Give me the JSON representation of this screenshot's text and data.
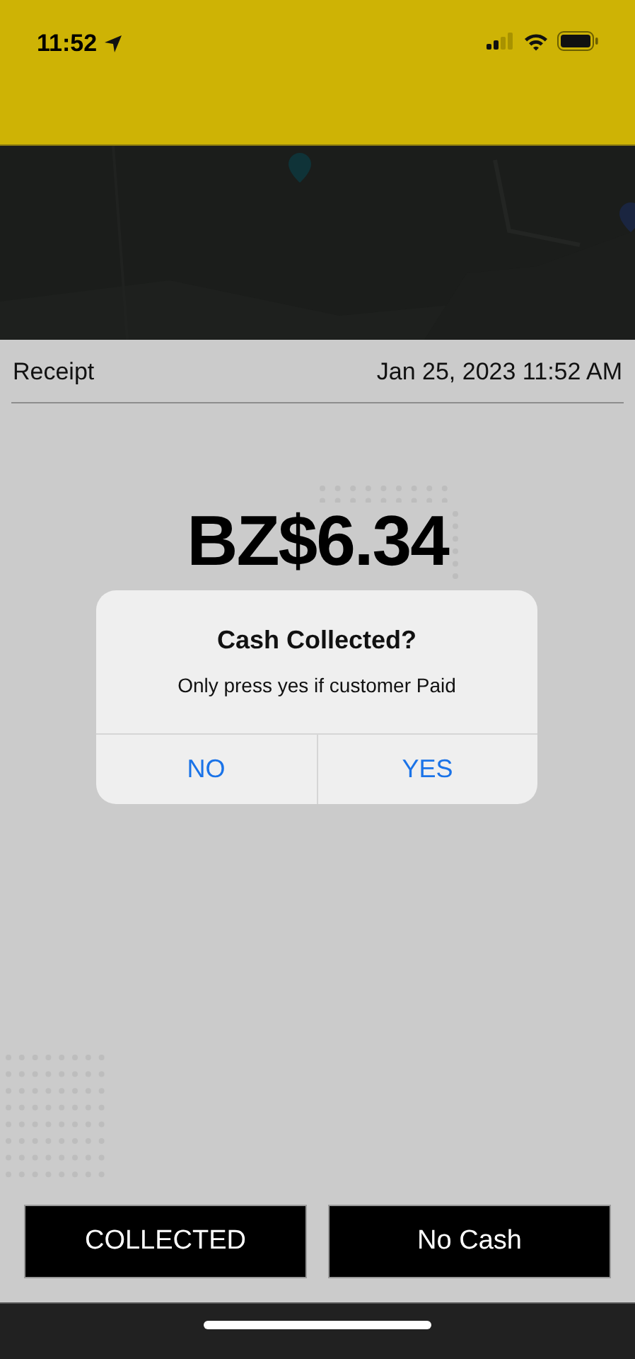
{
  "status_bar": {
    "time": "11:52"
  },
  "receipt": {
    "title": "Receipt",
    "date": "Jan 25, 2023 11:52 AM",
    "amount": "BZ$6.34"
  },
  "alert": {
    "title": "Cash Collected?",
    "message": "Only press yes if customer Paid",
    "buttons": [
      "NO",
      "YES"
    ]
  },
  "actions": [
    "COLLECTED",
    "No Cash"
  ]
}
